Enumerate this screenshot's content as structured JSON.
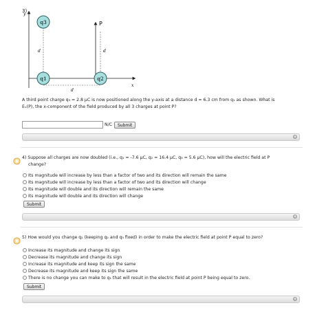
{
  "q3": {
    "number": "3)",
    "diagram": {
      "y_label": "y",
      "x_label": "x",
      "q3_label": "q3",
      "q1_label": "q1",
      "q2_label": "q2",
      "p_label": "P",
      "d_left": "d",
      "d_right": "d",
      "d_bottom": "d"
    },
    "text_line1": "A third point charge q₃ = 2.8 μC is now positioned along the y-axis at a distance d = 6.3 cm from q₁ as shown. What is",
    "text_line2": "Eₓ(P), the x-component of the field produced by all 3 charges at point P?",
    "answer_value": "",
    "unit": "N/C",
    "submit_label": "Submit"
  },
  "q4": {
    "number": "4)",
    "text_line1": "Suppose all charges are now doubled (i.e., q₁ = -7.6 μC, q₂ = 16.4 μC, q₃ = 5.6 μC), how will the electric field at P",
    "text_line2": "change?",
    "options": [
      "Its magnitude will increase by less than a factor of two and its direction will remain the same",
      "Its magnitude will increase by less than a factor of two and its direction will change",
      "Its magnitude will double and its direction will remain the same",
      "Its magnitude will double and its direction will change"
    ],
    "submit_label": "Submit"
  },
  "q5": {
    "number": "5)",
    "text_line1": "How would you change q₁ (keeping q₂ and q₃ fixed) in order to make the electric field at point P equal to zero?",
    "options": [
      "Increase its magnitude and change its sign",
      "Decrease its magnitude and change its sign",
      "Increase its magnitude and keep its sign the same",
      "Decrease its magnitude and keep its sign the same",
      "There is no change you can make to q₁ that will result in the electric field at point P being equal to zero."
    ],
    "submit_label": "Submit"
  },
  "colors": {
    "charge_fill": "#a8dede",
    "charge_border": "#2a5f62",
    "status_icon": "#e6b85a"
  }
}
